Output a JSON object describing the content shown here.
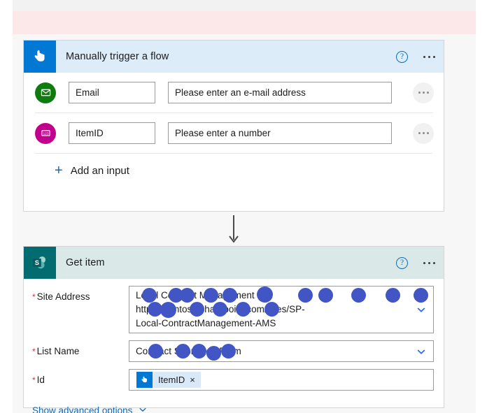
{
  "banner": {
    "visible": true,
    "color": "#fce8e8"
  },
  "trigger_card": {
    "title": "Manually trigger a flow",
    "icon": "touch-hand-icon",
    "icon_color": "#0078d4",
    "header_color": "#dcecf9",
    "help_label": "?",
    "inputs": [
      {
        "icon": "envelope-icon",
        "icon_color": "#107c10",
        "name": "Email",
        "placeholder": "Please enter an e-mail address"
      },
      {
        "icon": "number-123-icon",
        "icon_color": "#c2008e",
        "name": "ItemID",
        "placeholder": "Please enter a number"
      }
    ],
    "add_input_label": "Add an input",
    "add_input_plus": "+"
  },
  "connector_arrow": {
    "icon": "arrow-down-icon",
    "color": "#4a4a4a"
  },
  "action_card": {
    "title": "Get item",
    "icon": "sharepoint-icon",
    "icon_color": "#036c70",
    "header_color": "#dae9e7",
    "help_label": "?",
    "fields": [
      {
        "label": "Site Address",
        "required": true,
        "value_line1": "Local Contract Management - https://contoso.sharepoint.com/sites/SP-",
        "value_line2": "Local-ContractManagement-AMS",
        "redacted": true,
        "control": "combobox"
      },
      {
        "label": "List Name",
        "required": true,
        "value_line1": "Contract Submitted Form",
        "redacted": true,
        "control": "combobox"
      },
      {
        "label": "Id",
        "required": true,
        "control": "token-field",
        "token": {
          "icon": "touch-hand-icon",
          "label": "ItemID",
          "remove_label": "×"
        }
      }
    ],
    "advanced_options_label": "Show advanced options",
    "advanced_chevron": "chevron-down-icon"
  }
}
